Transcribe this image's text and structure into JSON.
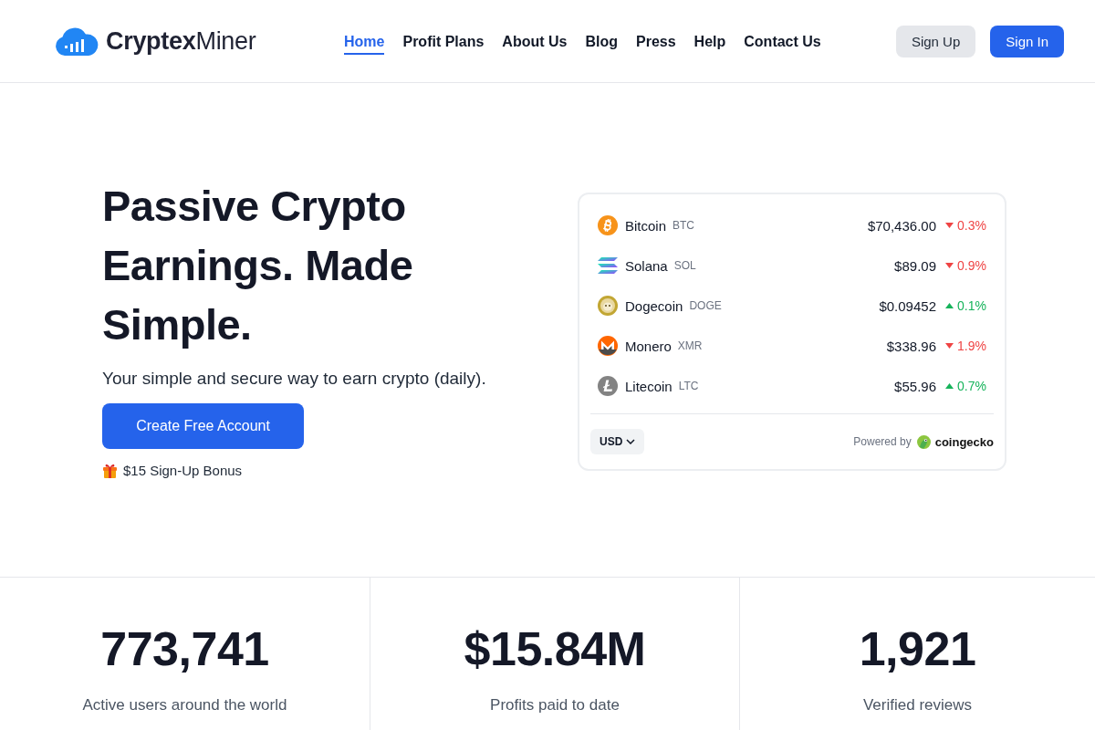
{
  "header": {
    "logo": "**Cryptex**Miner",
    "nav": [
      {
        "label": "Home",
        "selected": true
      },
      {
        "label": "Profit Plans",
        "selected": false
      },
      {
        "label": "About Us",
        "selected": false
      },
      {
        "label": "Blog",
        "selected": false
      },
      {
        "label": "Press",
        "selected": false
      },
      {
        "label": "Help",
        "selected": false
      },
      {
        "label": "Contact Us",
        "selected": false
      }
    ],
    "buttons": [
      {
        "label": "Sign Up",
        "kind": "secondary"
      },
      {
        "label": "Sign In",
        "kind": "primary"
      }
    ]
  },
  "hero": {
    "headline": "Passive Crypto Earnings. Made Simple.",
    "subtitle": "Your simple and secure way to earn crypto (daily).",
    "cta": "Create Free Account",
    "bonus": "$15 Sign-Up Bonus"
  },
  "ticker": {
    "coins": [
      {
        "name": "Bitcoin",
        "symbol": "BTC",
        "price": "$70,436.00",
        "change": "0.3%",
        "rising": false
      },
      {
        "name": "Solana",
        "symbol": "SOL",
        "price": "$89.09",
        "change": "0.9%",
        "rising": false
      },
      {
        "name": "Dogecoin",
        "symbol": "DOGE",
        "price": "$0.09452",
        "change": "0.1%",
        "rising": true
      },
      {
        "name": "Monero",
        "symbol": "XMR",
        "price": "$338.96",
        "change": "1.9%",
        "rising": false
      },
      {
        "name": "Litecoin",
        "symbol": "LTC",
        "price": "$55.96",
        "change": "0.7%",
        "rising": true
      }
    ],
    "currency": "USD",
    "powered_by": "Powered by",
    "provider": "coingecko"
  },
  "stats": [
    {
      "value": "773,741",
      "label": "Active users around the world"
    },
    {
      "value": "$15.84M",
      "label": "Profits paid to date"
    },
    {
      "value": "1,921",
      "label": "Verified reviews"
    }
  ]
}
